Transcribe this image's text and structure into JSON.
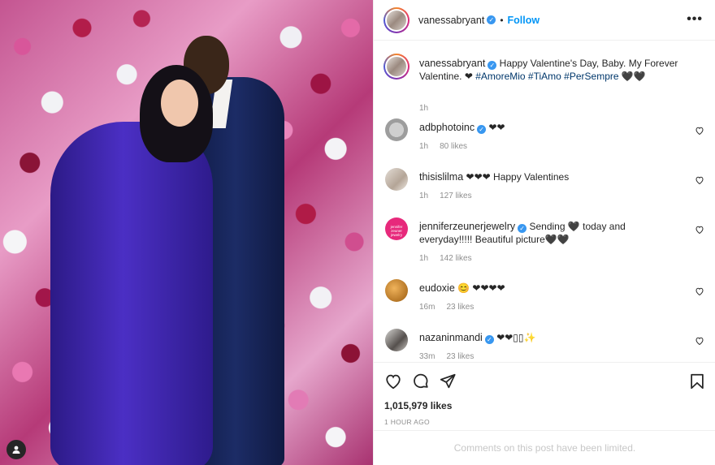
{
  "post": {
    "author": "vanessabryant",
    "follow_label": "Follow",
    "separator": "•",
    "more_icon": "more-horizontal-icon",
    "caption": {
      "username": "vanessabryant",
      "text_plain": "Happy Valentine's Day, Baby. My Forever Valentine. ❤ ",
      "hashtag_1": "#AmoreMio",
      "hashtag_2": "#TiAmo",
      "hashtag_3": "#PerSempre",
      "text_end": "🖤🖤",
      "time": "1h"
    },
    "comments": [
      {
        "username": "adbphotoinc",
        "verified": true,
        "text": "❤❤",
        "time": "1h",
        "likes": "80 likes"
      },
      {
        "username": "thisislilma",
        "verified": false,
        "text": "❤❤❤ Happy Valentines",
        "time": "1h",
        "likes": "127 likes"
      },
      {
        "username": "jenniferzeunerjewelry",
        "verified": true,
        "text": "Sending 🖤 today and everyday!!!!! Beautiful picture🖤🖤",
        "time": "1h",
        "likes": "142 likes",
        "avatar_text": "jennifer zeuner jewelry"
      },
      {
        "username": "eudoxie",
        "verified": false,
        "text": "😊 ❤❤❤❤",
        "time": "16m",
        "likes": "23 likes"
      },
      {
        "username": "nazaninmandi",
        "verified": true,
        "text": "❤❤▯▯✨",
        "time": "33m",
        "likes": "23 likes"
      }
    ],
    "likes_count": "1,015,979 likes",
    "post_time": "1 HOUR AGO",
    "comments_limited": "Comments on this post have been limited."
  },
  "colors": {
    "accent": "#0095f6",
    "verified": "#3897f0",
    "muted": "#8e8e8e",
    "hashtag": "#00376b"
  }
}
